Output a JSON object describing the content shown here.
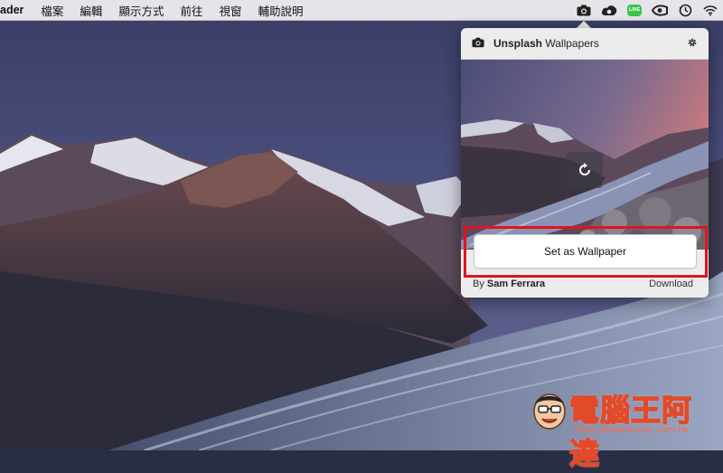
{
  "menubar": {
    "app_name": "ader",
    "menus": [
      "檔案",
      "編輯",
      "顯示方式",
      "前往",
      "視窗",
      "輔助說明"
    ]
  },
  "status_icons": [
    "camera-icon",
    "creative-cloud-icon",
    "line-icon",
    "nvidia-icon",
    "time-machine-icon",
    "wifi-icon"
  ],
  "status_line_label": "LINE",
  "popover": {
    "title_bold": "Unsplash",
    "title_rest": " Wallpapers",
    "set_wallpaper_label": "Set as Wallpaper",
    "by_prefix": "By ",
    "author": "Sam Ferrara",
    "download_label": "Download"
  },
  "colors": {
    "highlight_border": "#e0141e",
    "popover_bg": "#ececec",
    "line_green": "#3ac54a"
  },
  "watermark": {
    "text": "電腦王阿達",
    "url": "http://www.kocpc.com.tw"
  }
}
